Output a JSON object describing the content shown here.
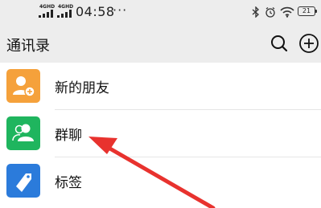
{
  "status_bar": {
    "network_1": "4GHD",
    "network_2": "4GHD",
    "time": "04:58",
    "more": "···",
    "battery": "21"
  },
  "header": {
    "title": "通讯录"
  },
  "contacts": {
    "items": [
      {
        "label": "新的朋友",
        "icon": "add-friend-icon",
        "color": "#F5A13B"
      },
      {
        "label": "群聊",
        "icon": "group-chat-icon",
        "color": "#1FB55E"
      },
      {
        "label": "标签",
        "icon": "tag-icon",
        "color": "#2B7BDB"
      }
    ]
  },
  "annotation": {
    "arrow_color": "#E8322E"
  }
}
